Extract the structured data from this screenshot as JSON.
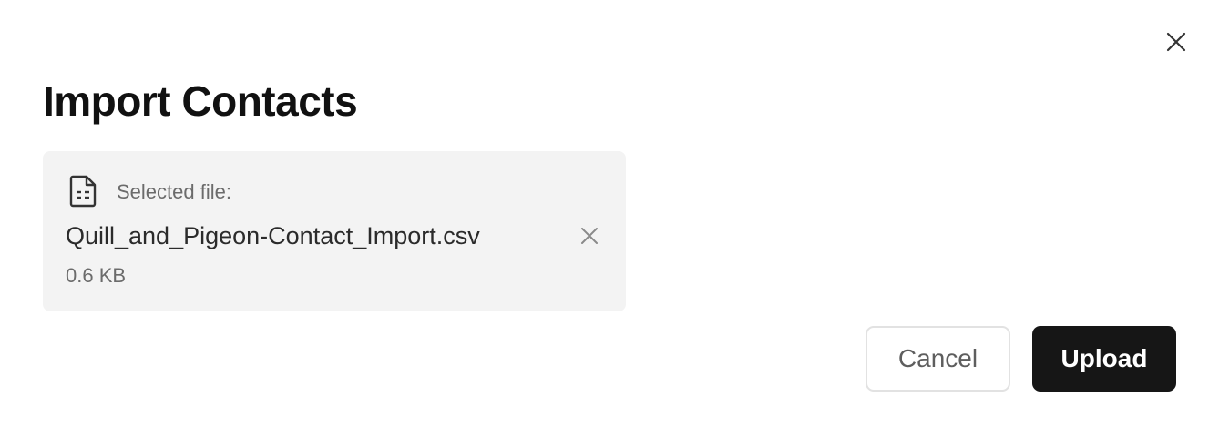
{
  "dialog": {
    "title": "Import Contacts",
    "close_icon": "close-icon"
  },
  "file": {
    "icon": "file-spreadsheet-icon",
    "label": "Selected file:",
    "name": "Quill_and_Pigeon-Contact_Import.csv",
    "size": "0.6 KB",
    "remove_icon": "close-icon"
  },
  "actions": {
    "cancel_label": "Cancel",
    "upload_label": "Upload"
  },
  "colors": {
    "primary": "#161616",
    "card_background": "#f3f3f3",
    "muted_text": "#6b6b6b"
  }
}
